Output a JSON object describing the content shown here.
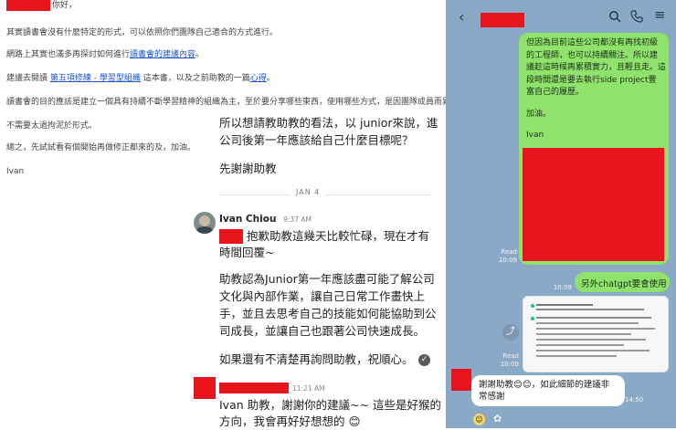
{
  "email": {
    "greeting": "你好，",
    "line1": "其實讀書會沒有什麼特定的形式，可以依照你們團隊自己適合的方式進行。",
    "line2_pre": "網路上其實也滿多再探討如何進行",
    "line2_link": "讀書會的建議內容",
    "line2_post": "。",
    "line3_pre": "建議去閱讀 ",
    "line3_link1": "第五項修練 - 學習型組織",
    "line3_mid": " 這本書，以及之前助教的一篇",
    "line3_link2": "心得",
    "line3_post": "。",
    "line4": "讀書會的目的應該是建立一個具有持續不斷學習精神的組織為主，至於要分享哪些東西，使用哪些方式，是因團隊成員而異。",
    "line5": "不需要太過拘泥於形式。",
    "line6": "總之，先試試看有個開始再做修正都來的及，加油。",
    "sign": "Ivan"
  },
  "question": {
    "line1": "所以想請教助教的看法，以 junior來說，進",
    "line2": "公司後第一年應該給自己什麼目標呢？",
    "thanks": "先謝謝助教"
  },
  "divider": {
    "date": "JAN 4"
  },
  "reply": {
    "author": "Ivan Chiou",
    "time": "9:37 AM",
    "line1": "抱歉助教這幾天比較忙碌，現在才有",
    "line2": "時間回覆~",
    "line3": "助教認為Junior第一年應該盡可能了解公司",
    "line4": "文化與內部作業，讓自己日常工作畫快上",
    "line5": "手，並且去思考自己的技能如何能協助到公",
    "line6": "司成長，並讓自己也跟著公司快速成長。",
    "line7": "如果還有不清楚再詢問助教，祝順心。"
  },
  "followup": {
    "time": "11:21 AM",
    "line1": "Ivan 助教，謝謝你的建議~~ 這些是好猴的",
    "line2": "方向，我會再好好想想的 😊"
  },
  "phone": {
    "green_bubble": {
      "line1": "但因為目前這些公司都沒有再找初級",
      "line2": "的工程師，也可以持續關注。所以建",
      "line3": "議趁這時候再累積實力，且輕且走。這",
      "line4": "段時間還是要去執行side project豐",
      "line5": "富自己的履歷。",
      "line6": "加油。",
      "line7": "Ivan"
    },
    "read_label": "Read",
    "time1": "10:09",
    "time2": "10:09",
    "chatgpt_bubble": "另外chatgpt要會使用",
    "read2": "Read",
    "time3": "10:09",
    "reply_bubble_line1": "謝謝助教😊😊，如此細節的建議非",
    "reply_bubble_line2": "常感謝",
    "time4": "14:50",
    "icons": [
      "back-icon",
      "search-icon",
      "phone-icon",
      "menu-icon",
      "share-icon",
      "emoji-icon"
    ]
  }
}
